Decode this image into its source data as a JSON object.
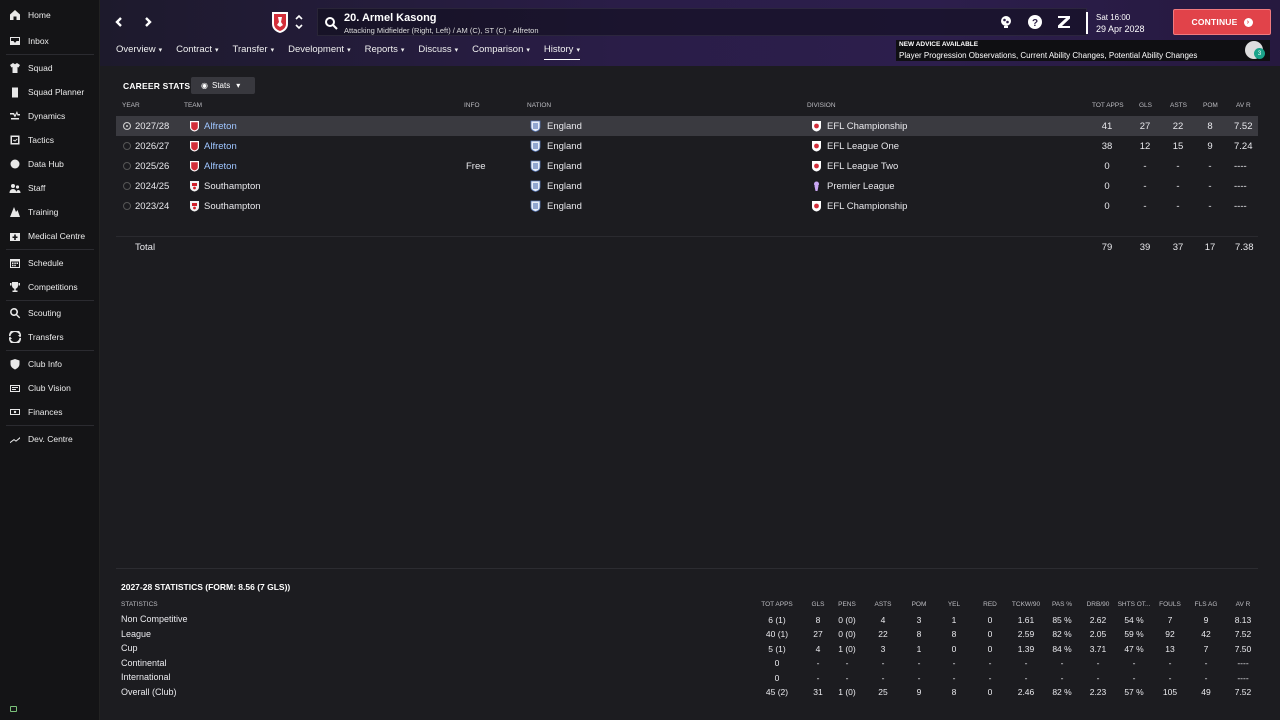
{
  "sidebar": {
    "items": [
      {
        "label": "Home",
        "icon": "home-icon"
      },
      {
        "label": "Inbox",
        "icon": "inbox-icon"
      },
      {
        "label": "Squad",
        "icon": "shirt-icon"
      },
      {
        "label": "Squad Planner",
        "icon": "clipboard-icon"
      },
      {
        "label": "Dynamics",
        "icon": "dynamics-icon"
      },
      {
        "label": "Tactics",
        "icon": "tactics-icon"
      },
      {
        "label": "Data Hub",
        "icon": "data-hub-icon"
      },
      {
        "label": "Staff",
        "icon": "staff-icon"
      },
      {
        "label": "Training",
        "icon": "training-icon"
      },
      {
        "label": "Medical Centre",
        "icon": "medical-icon"
      },
      {
        "label": "Schedule",
        "icon": "calendar-icon"
      },
      {
        "label": "Competitions",
        "icon": "trophy-icon"
      },
      {
        "label": "Scouting",
        "icon": "search-icon"
      },
      {
        "label": "Transfers",
        "icon": "transfer-icon"
      },
      {
        "label": "Club Info",
        "icon": "shield-icon"
      },
      {
        "label": "Club Vision",
        "icon": "vision-icon"
      },
      {
        "label": "Finances",
        "icon": "finances-icon"
      },
      {
        "label": "Dev. Centre",
        "icon": "dev-centre-icon"
      }
    ]
  },
  "header": {
    "player_name": "20. Armel Kasong",
    "player_sub": "Attacking Midfielder (Right, Left) / AM (C), ST (C) - Alfreton",
    "date_day": "Sat 16:00",
    "date_full": "29 Apr 2028",
    "continue_label": "CONTINUE"
  },
  "tabs": [
    {
      "label": "Overview"
    },
    {
      "label": "Contract"
    },
    {
      "label": "Transfer"
    },
    {
      "label": "Development"
    },
    {
      "label": "Reports"
    },
    {
      "label": "Discuss"
    },
    {
      "label": "Comparison"
    },
    {
      "label": "History"
    }
  ],
  "advice": {
    "title": "NEW ADVICE AVAILABLE",
    "text": "Player Progression Observations, Current Ability Changes, Potential Ability Changes",
    "count": "3"
  },
  "career": {
    "title": "CAREER STATS",
    "stats_button": "Stats",
    "headers": {
      "year": "YEAR",
      "team": "TEAM",
      "info": "INFO",
      "nation": "NATION",
      "division": "DIVISION",
      "apps": "TOT APPS",
      "gls": "GLS",
      "asts": "ASTS",
      "pom": "POM",
      "avr": "AV R"
    },
    "rows": [
      {
        "year": "2027/28",
        "team": "Alfreton",
        "info": "",
        "nation": "England",
        "division": "EFL Championship",
        "apps": "41",
        "gls": "27",
        "asts": "22",
        "pom": "8",
        "avr": "7.52"
      },
      {
        "year": "2026/27",
        "team": "Alfreton",
        "info": "",
        "nation": "England",
        "division": "EFL League One",
        "apps": "38",
        "gls": "12",
        "asts": "15",
        "pom": "9",
        "avr": "7.24"
      },
      {
        "year": "2025/26",
        "team": "Alfreton",
        "info": "Free",
        "nation": "England",
        "division": "EFL League Two",
        "apps": "0",
        "gls": "-",
        "asts": "-",
        "pom": "-",
        "avr": "----"
      },
      {
        "year": "2024/25",
        "team": "Southampton",
        "info": "",
        "nation": "England",
        "division": "Premier League",
        "apps": "0",
        "gls": "-",
        "asts": "-",
        "pom": "-",
        "avr": "----"
      },
      {
        "year": "2023/24",
        "team": "Southampton",
        "info": "",
        "nation": "England",
        "division": "EFL Championship",
        "apps": "0",
        "gls": "-",
        "asts": "-",
        "pom": "-",
        "avr": "----"
      }
    ],
    "total": {
      "label": "Total",
      "apps": "79",
      "gls": "39",
      "asts": "37",
      "pom": "17",
      "avr": "7.38"
    }
  },
  "season_stats": {
    "title": "2027-28 STATISTICS (FORM: 8.56 (7 GLS))",
    "headers": [
      "STATISTICS",
      "TOT APPS",
      "GLS",
      "PENS",
      "ASTS",
      "POM",
      "YEL",
      "RED",
      "TCKW/90",
      "PAS %",
      "DRB/90",
      "SHTS OT...",
      "FOULS",
      "FLS AG",
      "AV R"
    ],
    "rows": [
      {
        "label": "Non Competitive",
        "values": [
          "6 (1)",
          "8",
          "0 (0)",
          "4",
          "3",
          "1",
          "0",
          "1.61",
          "85 %",
          "2.62",
          "54 %",
          "7",
          "9",
          "8.13"
        ]
      },
      {
        "label": "League",
        "values": [
          "40 (1)",
          "27",
          "0 (0)",
          "22",
          "8",
          "8",
          "0",
          "2.59",
          "82 %",
          "2.05",
          "59 %",
          "92",
          "42",
          "7.52"
        ]
      },
      {
        "label": "Cup",
        "values": [
          "5 (1)",
          "4",
          "1 (0)",
          "3",
          "1",
          "0",
          "0",
          "1.39",
          "84 %",
          "3.71",
          "47 %",
          "13",
          "7",
          "7.50"
        ]
      },
      {
        "label": "Continental",
        "values": [
          "0",
          "-",
          "-",
          "-",
          "-",
          "-",
          "-",
          "-",
          "-",
          "-",
          "-",
          "-",
          "-",
          "----"
        ]
      },
      {
        "label": "International",
        "values": [
          "0",
          "-",
          "-",
          "-",
          "-",
          "-",
          "-",
          "-",
          "-",
          "-",
          "-",
          "-",
          "-",
          "----"
        ]
      },
      {
        "label": "Overall (Club)",
        "values": [
          "45 (2)",
          "31",
          "1 (0)",
          "25",
          "9",
          "8",
          "0",
          "2.46",
          "82 %",
          "2.23",
          "57 %",
          "105",
          "49",
          "7.52"
        ]
      }
    ]
  }
}
